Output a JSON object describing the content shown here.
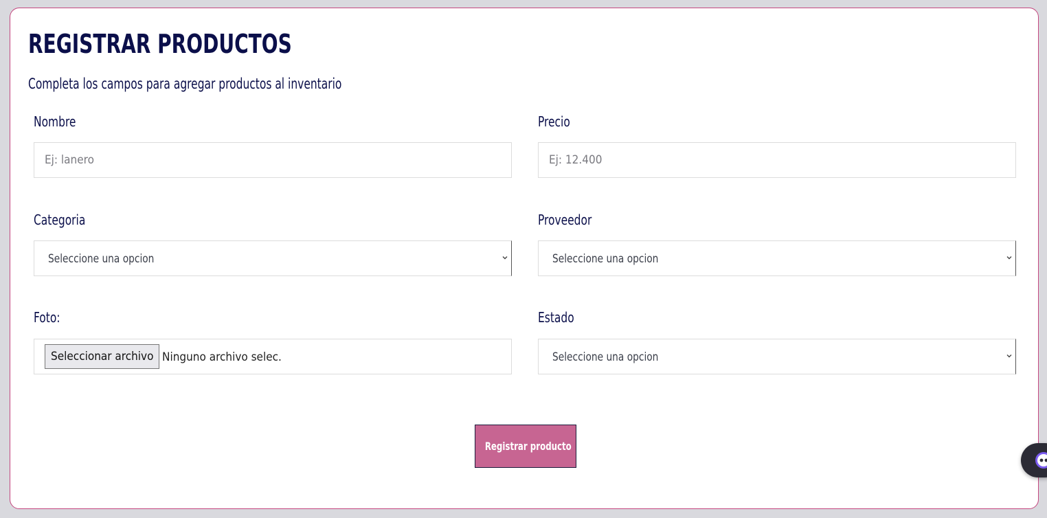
{
  "form": {
    "title": "REGISTRAR PRODUCTOS",
    "subtitle": "Completa los campos para agregar productos al inventario",
    "nombre": {
      "label": "Nombre",
      "placeholder": "Ej: lanero"
    },
    "precio": {
      "label": "Precio",
      "placeholder": "Ej: 12.400"
    },
    "categoria": {
      "label": "Categoria",
      "selected": "Seleccione una opcion"
    },
    "proveedor": {
      "label": "Proveedor",
      "selected": "Seleccione una opcion"
    },
    "foto": {
      "label": "Foto:",
      "button_label": "Seleccionar archivo",
      "status": "Ninguno archivo selec."
    },
    "estado": {
      "label": "Estado",
      "selected": "Seleccione una opcion"
    },
    "submit_label": "Registrar producto"
  },
  "colors": {
    "accent": "#c76592",
    "border_accent": "#c4467e",
    "heading": "#0b0f4a"
  },
  "icons": {
    "select_arrow": "chevron-down-icon",
    "assistant": "assistant-bot-icon"
  }
}
